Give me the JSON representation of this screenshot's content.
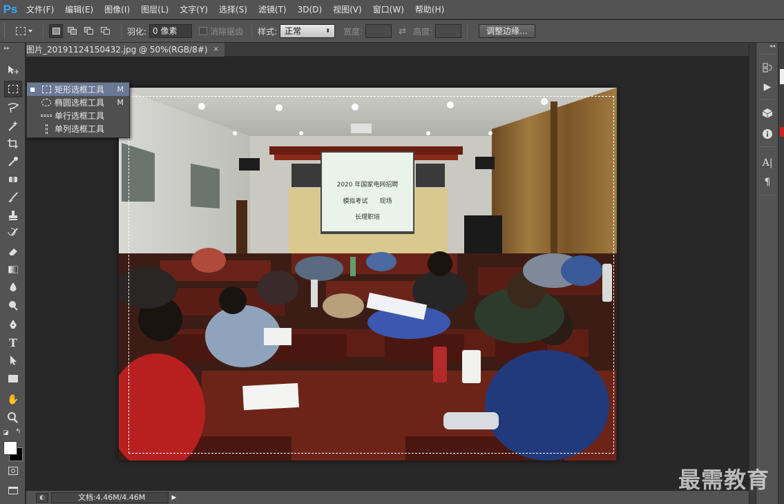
{
  "app": {
    "logo": "Ps"
  },
  "menu": [
    "文件(F)",
    "编辑(E)",
    "图像(I)",
    "图层(L)",
    "文字(Y)",
    "选择(S)",
    "滤镜(T)",
    "3D(D)",
    "视图(V)",
    "窗口(W)",
    "帮助(H)"
  ],
  "options": {
    "feather_label": "羽化:",
    "feather_value": "0 像素",
    "antialias_label": "消除锯齿",
    "style_label": "样式:",
    "style_value": "正常",
    "width_label": "宽度:",
    "height_label": "高度:",
    "refine_edge_button": "调整边缘..."
  },
  "document": {
    "tab_title": "图片_20191124150432.jpg @ 50%(RGB/8#)",
    "close_glyph": "×"
  },
  "photo": {
    "screen_line1": "2020 年国家电网招聘",
    "screen_line2": "模拟考试      现场",
    "screen_line3": "长理职培"
  },
  "tool_flyout": {
    "items": [
      {
        "label": "矩形选框工具",
        "key": "M",
        "icon": "rect-marquee-icon",
        "selected": true
      },
      {
        "label": "椭圆选框工具",
        "key": "M",
        "icon": "ellipse-marquee-icon",
        "selected": false
      },
      {
        "label": "单行选框工具",
        "key": "",
        "icon": "single-row-marquee-icon",
        "selected": false
      },
      {
        "label": "单列选框工具",
        "key": "",
        "icon": "single-column-marquee-icon",
        "selected": false
      }
    ]
  },
  "status": {
    "doc_size": "文档:4.46M/4.46M"
  },
  "watermark": "最需教育",
  "colors": {
    "panel": "#535353",
    "canvas": "#282828",
    "accent": "#31a8ff",
    "flyout_selected": "#6a7895"
  }
}
